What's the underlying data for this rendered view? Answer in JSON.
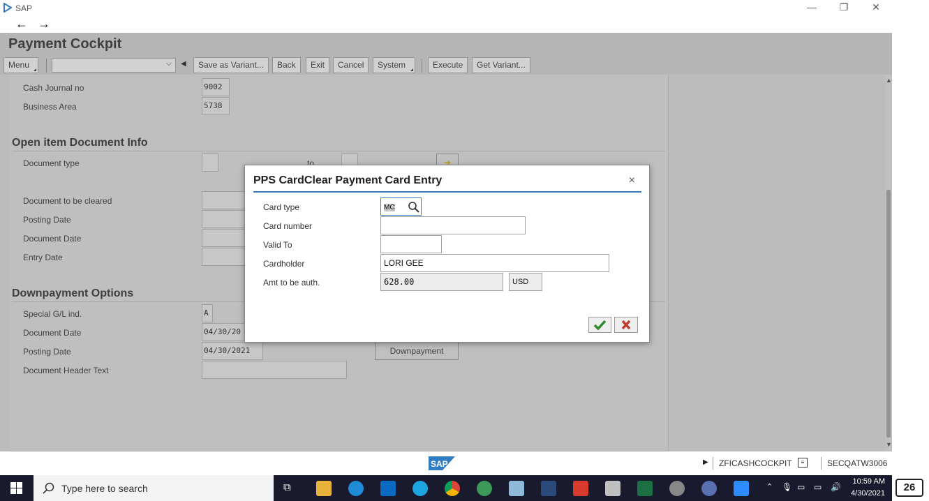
{
  "window": {
    "title": "SAP",
    "minimize": "—",
    "restore": "❐",
    "close": "✕"
  },
  "nav": {
    "back": "←",
    "forward": "→"
  },
  "app": {
    "title": "Payment Cockpit"
  },
  "toolbar": {
    "menu": "Menu",
    "variant_select": "",
    "save_as_variant": "Save as Variant...",
    "back": "Back",
    "exit": "Exit",
    "cancel": "Cancel",
    "system": "System",
    "execute": "Execute",
    "get_variant": "Get Variant..."
  },
  "form": {
    "cash_journal_label": "Cash Journal  no",
    "cash_journal_value": "9002",
    "business_area_label": "Business Area",
    "business_area_value": "5738",
    "open_item_section": "Open item Document Info",
    "document_type_label": "Document type",
    "to_label": "to",
    "document_to_be_cleared_label": "Document to be cleared",
    "posting_date_label": "Posting Date",
    "document_date_label": "Document Date",
    "entry_date_label": "Entry Date",
    "downpayment_section": "Downpayment Options",
    "special_gl_label": "Special G/L ind.",
    "special_gl_value": "A",
    "dp_document_date_label": "Document Date",
    "dp_document_date_value": "04/30/20",
    "dp_posting_date_label": "Posting Date",
    "dp_posting_date_value": "04/30/2021",
    "document_header_text_label": "Document Header Text",
    "downpayment_button": "Downpayment"
  },
  "dialog": {
    "title": "PPS CardClear Payment Card Entry",
    "close": "×",
    "card_type_label": "Card type",
    "card_type_value": "MC",
    "card_number_label": "Card number",
    "card_number_value": "",
    "valid_to_label": "Valid To",
    "valid_to_value": "",
    "cardholder_label": "Cardholder",
    "cardholder_value": "LORI GEE",
    "amount_label": "Amt to be auth.",
    "amount_value": "628.00",
    "currency_value": "USD"
  },
  "footer": {
    "transaction": "ZFICASHCOCKPIT",
    "system": "SECQATW3006"
  },
  "taskbar": {
    "search_placeholder": "Type here to search",
    "time": "10:59 AM",
    "date": "4/30/2021"
  },
  "badge": "26",
  "colors": {
    "accent_line": "#3a7bbf",
    "ok_check": "#2e8b2e",
    "cancel_x": "#c0392b"
  }
}
